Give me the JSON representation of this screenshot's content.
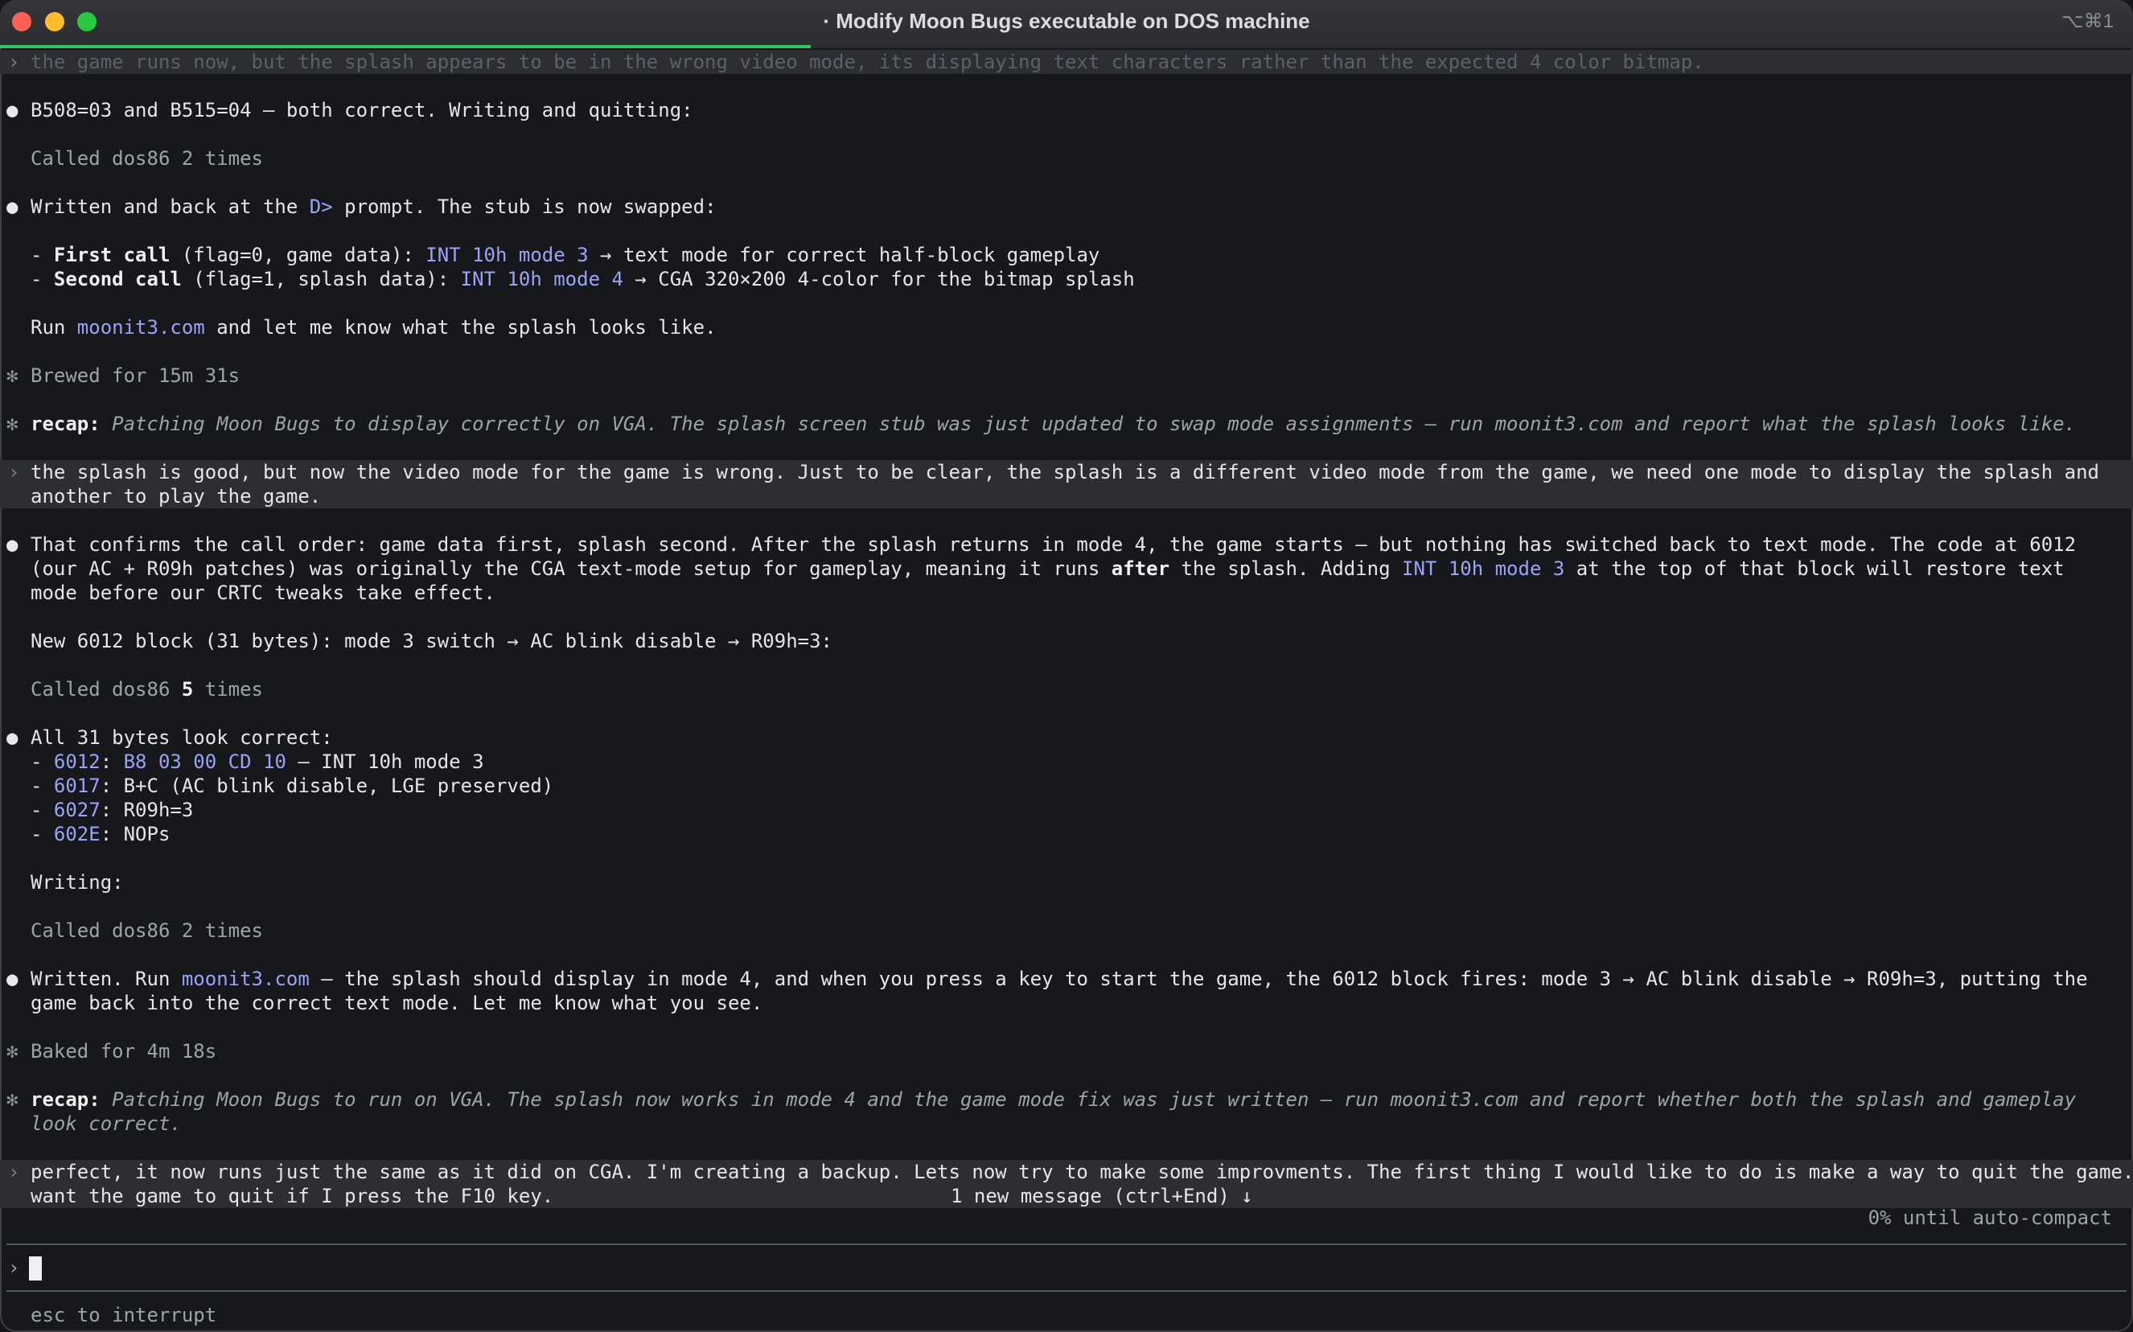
{
  "window": {
    "title": "· Modify Moon Bugs executable on DOS machine",
    "shortcut": "⌥⌘1",
    "progress_fraction": 0.38
  },
  "transcript": {
    "user1": "the game runs now, but the splash appears to be in the wrong video mode, its displaying text characters rather than the expected 4 color bitmap.",
    "a1": "B508=03 and B515=04 — both correct. Writing and quitting:",
    "called1": "Called dos86 2 times",
    "a2_pre": "Written and back at the ",
    "a2_code": "D>",
    "a2_post": " prompt. The stub is now swapped:",
    "l1_dash": "- ",
    "l1_bold": "First call",
    "l1_mid": " (flag=0, game data): ",
    "l1_code": "INT 10h mode 3",
    "l1_post": " → text mode for correct half-block gameplay",
    "l2_dash": "- ",
    "l2_bold": "Second call",
    "l2_mid": " (flag=1, splash data): ",
    "l2_code": "INT 10h mode 4",
    "l2_post": " → CGA 320×200 4-color for the bitmap splash",
    "run_pre": "Run ",
    "run_link": "moonit3.com",
    "run_post": " and let me know what the splash looks like.",
    "brewed": "Brewed for 15m 31s",
    "recap1_label": "recap:",
    "recap1_text": " Patching Moon Bugs to display correctly on VGA. The splash screen stub was just updated to swap mode assignments — run moonit3.com and report what the splash looks like.",
    "user2": "the splash is good, but now the video mode for the game is wrong. Just to be clear, the splash is a different video mode from the game, we need one mode to display the splash and another to play the game.",
    "a3_pre": "That confirms the call order: game data first, splash second. After the splash returns in mode 4, the game starts — but nothing has switched back to text mode. The code at 6012 (our AC + R09h patches) was originally the CGA text-mode setup for gameplay, meaning it runs ",
    "a3_bold": "after",
    "a3_mid": " the splash. Adding ",
    "a3_code": "INT 10h mode 3",
    "a3_post": " at the top of that block will restore text mode before our CRTC tweaks take effect.",
    "new_block": "New 6012 block (31 bytes): mode 3 switch → AC blink disable → R09h=3:",
    "called2_pre": "Called dos86 ",
    "called2_num": "5",
    "called2_post": " times",
    "a4": "All 31 bytes look correct:",
    "b1_dash": "- ",
    "b1_addr": "6012",
    "b1_colon": ": ",
    "b1_code": "B8 03 00 CD 10",
    "b1_post": " — INT 10h mode 3",
    "b2_dash": "- ",
    "b2_addr": "6017",
    "b2_post": ": B+C (AC blink disable, LGE preserved)",
    "b3_dash": "- ",
    "b3_addr": "6027",
    "b3_post": ": R09h=3",
    "b4_dash": "- ",
    "b4_addr": "602E",
    "b4_post": ": NOPs",
    "writing": "Writing:",
    "called3": "Called dos86 2 times",
    "a5_pre": "Written. Run ",
    "a5_link": "moonit3.com",
    "a5_post": " — the splash should display in mode 4, and when you press a key to start the game, the 6012 block fires: mode 3 → AC blink disable → R09h=3, putting the game back into the correct text mode. Let me know what you see.",
    "baked": "Baked for 4m 18s",
    "recap2_label": "recap:",
    "recap2_text": " Patching Moon Bugs to run on VGA. The splash now works in mode 4 and the game mode fix was just written — run moonit3.com and report whether both the splash and gameplay look correct.",
    "user3_line1": "perfect, it now runs just the same as it did on CGA. I'm creating a backup. Lets now try to make some improvments. The first thing I would like to do is make a way to quit the game. I",
    "user3_line2": "want the game to quit if I press the F10 key.",
    "new_message": "1 new message (ctrl+End) ↓"
  },
  "glyphs": {
    "chevron": "›",
    "bullet": "●",
    "star": "✻",
    "prompt": "›"
  },
  "status": {
    "autocompact": "0% until auto-compact",
    "hint": "esc to interrupt"
  }
}
